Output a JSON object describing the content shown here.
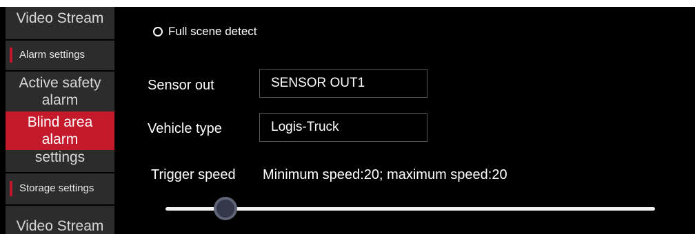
{
  "sidebar": {
    "video_stream_top": "Video Stream",
    "alarm_settings": "Alarm settings",
    "active_safety_line1": "Active safety",
    "active_safety_line2": "alarm",
    "blind_area_line1": "Blind area",
    "blind_area_line2": "alarm",
    "settings": "settings",
    "storage_settings": "Storage settings",
    "video_stream_bottom": "Video Stream"
  },
  "main": {
    "full_scene_label": "Full scene detect",
    "sensor_out_label": "Sensor out",
    "sensor_out_value": "SENSOR OUT1",
    "vehicle_type_label": "Vehicle type",
    "vehicle_type_value": "Logis-Truck",
    "trigger_speed_label": "Trigger speed",
    "trigger_speed_text": "Minimum speed:20; maximum speed:20"
  },
  "colors": {
    "accent": "#c41a2b",
    "sidebar_bg": "#2c2c2c",
    "background": "#000000"
  }
}
